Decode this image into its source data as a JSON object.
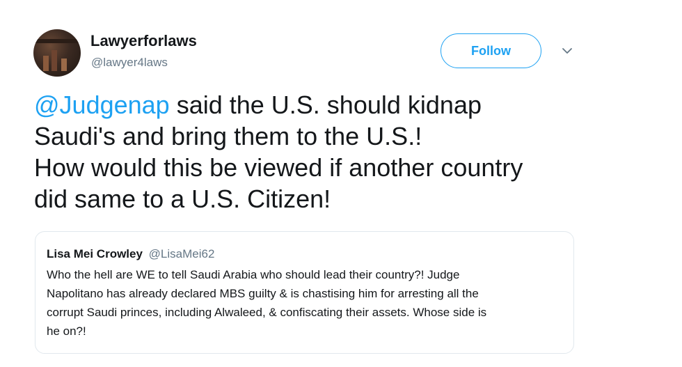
{
  "tweet": {
    "author": {
      "display_name": "Lawyerforlaws",
      "handle": "@lawyer4laws"
    },
    "follow_label": "Follow",
    "text": {
      "mention": "@Judgenap",
      "line1_rest": " said the U.S. should kidnap",
      "line2": "Saudi's and bring them to the U.S.!",
      "line3": "How would this be viewed if another country",
      "line4": "did same to a U.S. Citizen!"
    },
    "quoted": {
      "display_name": "Lisa Mei Crowley",
      "handle": "@LisaMei62",
      "lines": [
        "Who the hell are WE to tell Saudi Arabia who should lead their country?! Judge",
        "Napolitano has already declared MBS guilty & is chastising him for arresting all the",
        "corrupt Saudi princes, including Alwaleed, & confiscating their assets. Whose side is",
        "he on?!"
      ]
    }
  },
  "colors": {
    "accent": "#1da1f2",
    "text": "#14171a",
    "secondary": "#657786",
    "border": "#e1e8ed"
  },
  "icons": {
    "menu": "chevron-down-icon"
  }
}
